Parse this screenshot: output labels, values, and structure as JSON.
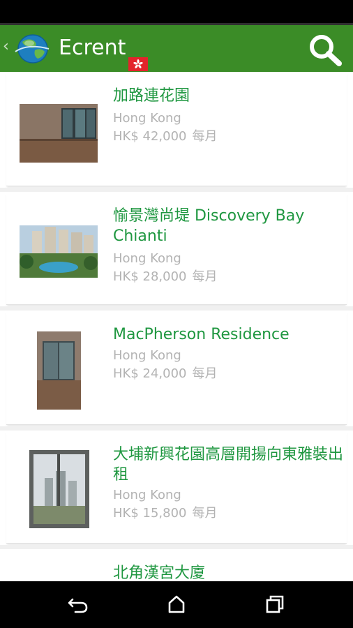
{
  "app": {
    "title": "Ecrent"
  },
  "listings": [
    {
      "title": "加路連花園",
      "location": "Hong Kong",
      "price": "HK$ 42,000",
      "unit": "每月"
    },
    {
      "title": "愉景灣尚堤 Discovery Bay Chianti",
      "location": "Hong Kong",
      "price": "HK$ 28,000",
      "unit": "每月"
    },
    {
      "title": "MacPherson Residence",
      "location": "Hong Kong",
      "price": "HK$ 24,000",
      "unit": "每月"
    },
    {
      "title": "大埔新興花園高層開揚向東雅裝出租",
      "location": "Hong Kong",
      "price": "HK$ 15,800",
      "unit": "每月"
    },
    {
      "title": "北角漢宮大廈"
    }
  ],
  "colors": {
    "app_bar": "#3b8c27",
    "title_green": "#1f9740",
    "muted_text": "#b3b3b3"
  },
  "icons": {
    "search": "search-icon",
    "back": "back-chevron-icon",
    "flag": "hong-kong-flag-icon"
  }
}
